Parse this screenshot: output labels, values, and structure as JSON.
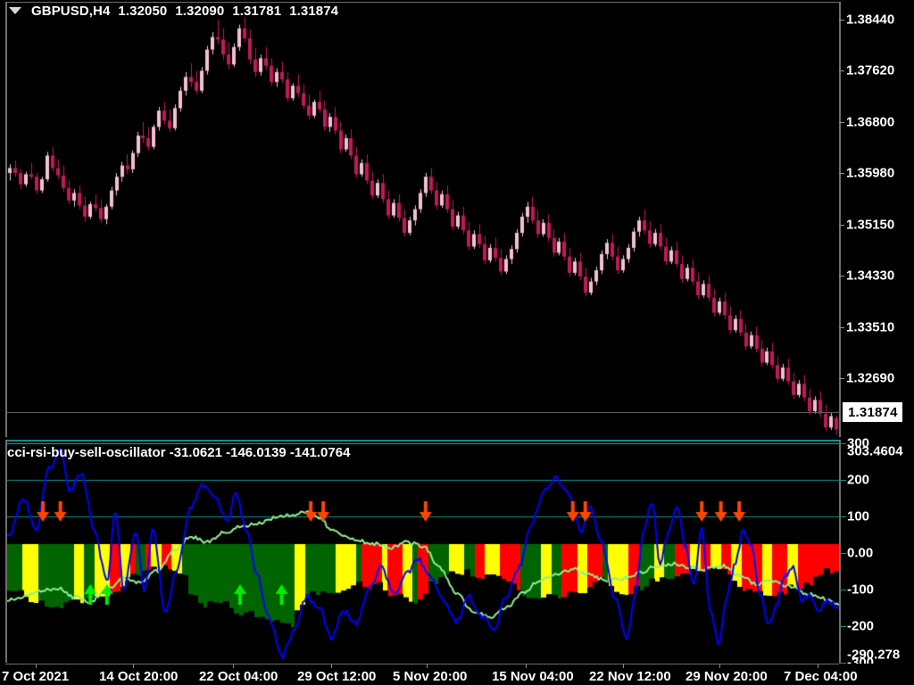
{
  "window": {
    "background": "#000000"
  },
  "header": {
    "dropdown_icon": "triangle-down-icon",
    "symbol": "GBPUSD,H4",
    "open": "1.32050",
    "high": "1.32090",
    "low": "1.31781",
    "close": "1.31874"
  },
  "price_pane": {
    "current_price": "1.31874",
    "scale_labels": [
      "1.38440",
      "1.37620",
      "1.36800",
      "1.35980",
      "1.35150",
      "1.34330",
      "1.33510",
      "1.32690"
    ]
  },
  "indicator_pane": {
    "name": "cci-rsi-buy-sell-oscillator",
    "value_1": "-31.0621",
    "value_2": "-146.0139",
    "value_3": "-141.0764",
    "scale_labels": [
      "300",
      "200",
      "100",
      "0.00",
      "-100",
      "-200",
      "-300"
    ],
    "scale_max_label": "303.4604",
    "scale_min_label": "-290.278",
    "colors": {
      "line_blue": "#0000ff",
      "line_green": "#90ee90",
      "grid_teal": "#0f8f8f",
      "bar_green": "#006400",
      "bar_red": "#ff0000",
      "bar_yellow": "#ffff00",
      "arrow_down": "#ff4500",
      "arrow_up": "#00ee00"
    }
  },
  "time_axis": {
    "labels": [
      "7 Oct 2021",
      "14 Oct 20:00",
      "22 Oct 04:00",
      "29 Oct 12:00",
      "5 Nov 20:00",
      "15 Nov 04:00",
      "22 Nov 12:00",
      "29 Nov 20:00",
      "7 Dec 04:00"
    ]
  },
  "chart_data": {
    "type": "line",
    "title": "GBPUSD,H4",
    "subtitle": "cci-rsi-buy-sell-oscillator",
    "xlabel": "",
    "ylabel": "",
    "panes": [
      {
        "name": "price",
        "type": "candlestick",
        "ylim": [
          1.312,
          1.389
        ],
        "yticks": [
          1.3844,
          1.3762,
          1.368,
          1.3598,
          1.3515,
          1.3433,
          1.3351,
          1.3269
        ],
        "current_price": 1.31874,
        "ohlc_header": {
          "open": 1.3205,
          "high": 1.3209,
          "low": 1.31781,
          "close": 1.31874
        },
        "up_color": "#f3c0cf",
        "down_color": "#c2185b",
        "candles": [
          [
            1.3598,
            1.3612,
            1.3586,
            1.3606
          ],
          [
            1.3606,
            1.3618,
            1.3592,
            1.3598
          ],
          [
            1.3598,
            1.3604,
            1.3572,
            1.358
          ],
          [
            1.358,
            1.36,
            1.3576,
            1.3596
          ],
          [
            1.3596,
            1.3614,
            1.3588,
            1.3592
          ],
          [
            1.3592,
            1.3598,
            1.3564,
            1.357
          ],
          [
            1.357,
            1.3592,
            1.3566,
            1.3588
          ],
          [
            1.3588,
            1.3632,
            1.3584,
            1.3626
          ],
          [
            1.3626,
            1.364,
            1.36,
            1.3606
          ],
          [
            1.3606,
            1.362,
            1.3588,
            1.3594
          ],
          [
            1.3594,
            1.361,
            1.3568,
            1.3574
          ],
          [
            1.3574,
            1.3586,
            1.3548,
            1.3554
          ],
          [
            1.3554,
            1.3572,
            1.3544,
            1.3566
          ],
          [
            1.3566,
            1.3578,
            1.354,
            1.3546
          ],
          [
            1.3546,
            1.356,
            1.352,
            1.3528
          ],
          [
            1.3528,
            1.3552,
            1.3524,
            1.3548
          ],
          [
            1.3548,
            1.3564,
            1.3536,
            1.3542
          ],
          [
            1.3542,
            1.3556,
            1.3518,
            1.3524
          ],
          [
            1.3524,
            1.3548,
            1.3516,
            1.3544
          ],
          [
            1.3544,
            1.3576,
            1.354,
            1.357
          ],
          [
            1.357,
            1.3598,
            1.3562,
            1.3592
          ],
          [
            1.3592,
            1.3616,
            1.3584,
            1.361
          ],
          [
            1.361,
            1.3628,
            1.3596,
            1.3604
          ],
          [
            1.3604,
            1.3634,
            1.3598,
            1.363
          ],
          [
            1.363,
            1.3664,
            1.3624,
            1.3658
          ],
          [
            1.3658,
            1.368,
            1.3646,
            1.3654
          ],
          [
            1.3654,
            1.3672,
            1.3634,
            1.364
          ],
          [
            1.364,
            1.3676,
            1.3636,
            1.3672
          ],
          [
            1.3672,
            1.3704,
            1.3666,
            1.3698
          ],
          [
            1.3698,
            1.3712,
            1.3676,
            1.3682
          ],
          [
            1.3682,
            1.37,
            1.3664,
            1.367
          ],
          [
            1.367,
            1.3708,
            1.3666,
            1.3702
          ],
          [
            1.3702,
            1.3736,
            1.3696,
            1.373
          ],
          [
            1.373,
            1.376,
            1.3722,
            1.3752
          ],
          [
            1.3752,
            1.3774,
            1.3736,
            1.3744
          ],
          [
            1.3744,
            1.3762,
            1.3724,
            1.373
          ],
          [
            1.373,
            1.3768,
            1.3726,
            1.3762
          ],
          [
            1.3762,
            1.3802,
            1.3756,
            1.3796
          ],
          [
            1.3796,
            1.3824,
            1.3788,
            1.3816
          ],
          [
            1.3816,
            1.3844,
            1.3804,
            1.3812
          ],
          [
            1.3812,
            1.383,
            1.378,
            1.3788
          ],
          [
            1.3788,
            1.3808,
            1.3764,
            1.3772
          ],
          [
            1.3772,
            1.3806,
            1.3768,
            1.38
          ],
          [
            1.38,
            1.3836,
            1.3794,
            1.383
          ],
          [
            1.383,
            1.3848,
            1.3808,
            1.3814
          ],
          [
            1.3814,
            1.3828,
            1.3772,
            1.378
          ],
          [
            1.378,
            1.3798,
            1.3752,
            1.376
          ],
          [
            1.376,
            1.3788,
            1.3754,
            1.3782
          ],
          [
            1.3782,
            1.38,
            1.3764,
            1.377
          ],
          [
            1.377,
            1.3782,
            1.3738,
            1.3744
          ],
          [
            1.3744,
            1.3766,
            1.3736,
            1.376
          ],
          [
            1.376,
            1.3776,
            1.3742,
            1.3748
          ],
          [
            1.3748,
            1.376,
            1.3712,
            1.3718
          ],
          [
            1.3718,
            1.3742,
            1.3714,
            1.3738
          ],
          [
            1.3738,
            1.3756,
            1.372,
            1.3726
          ],
          [
            1.3726,
            1.374,
            1.37,
            1.3706
          ],
          [
            1.3706,
            1.3724,
            1.3684,
            1.369
          ],
          [
            1.369,
            1.3716,
            1.3686,
            1.3712
          ],
          [
            1.3712,
            1.373,
            1.3694,
            1.37
          ],
          [
            1.37,
            1.3714,
            1.3666,
            1.3672
          ],
          [
            1.3672,
            1.3694,
            1.3664,
            1.3688
          ],
          [
            1.3688,
            1.3704,
            1.366,
            1.3666
          ],
          [
            1.3666,
            1.368,
            1.363,
            1.3636
          ],
          [
            1.3636,
            1.366,
            1.3632,
            1.3654
          ],
          [
            1.3654,
            1.3668,
            1.362,
            1.3626
          ],
          [
            1.3626,
            1.364,
            1.359,
            1.3596
          ],
          [
            1.3596,
            1.362,
            1.3592,
            1.3614
          ],
          [
            1.3614,
            1.3628,
            1.358,
            1.3586
          ],
          [
            1.3586,
            1.36,
            1.3556,
            1.3562
          ],
          [
            1.3562,
            1.3588,
            1.3558,
            1.3582
          ],
          [
            1.3582,
            1.3596,
            1.355,
            1.3556
          ],
          [
            1.3556,
            1.357,
            1.3524,
            1.353
          ],
          [
            1.353,
            1.3556,
            1.3526,
            1.355
          ],
          [
            1.355,
            1.3564,
            1.352,
            1.3526
          ],
          [
            1.3526,
            1.354,
            1.3496,
            1.3502
          ],
          [
            1.3502,
            1.3528,
            1.3498,
            1.3522
          ],
          [
            1.3522,
            1.3546,
            1.3514,
            1.354
          ],
          [
            1.354,
            1.3572,
            1.3534,
            1.3566
          ],
          [
            1.3566,
            1.3598,
            1.356,
            1.3592
          ],
          [
            1.3592,
            1.3606,
            1.3564,
            1.357
          ],
          [
            1.357,
            1.3584,
            1.354,
            1.3546
          ],
          [
            1.3546,
            1.357,
            1.3542,
            1.3564
          ],
          [
            1.3564,
            1.3578,
            1.3534,
            1.354
          ],
          [
            1.354,
            1.3554,
            1.3506,
            1.3512
          ],
          [
            1.3512,
            1.3536,
            1.3508,
            1.353
          ],
          [
            1.353,
            1.3544,
            1.35,
            1.3506
          ],
          [
            1.3506,
            1.352,
            1.3474,
            1.348
          ],
          [
            1.348,
            1.3506,
            1.3476,
            1.35
          ],
          [
            1.35,
            1.3516,
            1.3478,
            1.3484
          ],
          [
            1.3484,
            1.3498,
            1.3452,
            1.3458
          ],
          [
            1.3458,
            1.3484,
            1.3454,
            1.3478
          ],
          [
            1.3478,
            1.3494,
            1.3456,
            1.3462
          ],
          [
            1.3462,
            1.3476,
            1.3434,
            1.344
          ],
          [
            1.344,
            1.3466,
            1.3436,
            1.346
          ],
          [
            1.346,
            1.3482,
            1.3452,
            1.3476
          ],
          [
            1.3476,
            1.3508,
            1.347,
            1.3502
          ],
          [
            1.3502,
            1.3534,
            1.3496,
            1.3528
          ],
          [
            1.3528,
            1.3552,
            1.3518,
            1.3544
          ],
          [
            1.3544,
            1.356,
            1.3516,
            1.3522
          ],
          [
            1.3522,
            1.3538,
            1.3494,
            1.35
          ],
          [
            1.35,
            1.3524,
            1.3496,
            1.3518
          ],
          [
            1.3518,
            1.3532,
            1.3488,
            1.3494
          ],
          [
            1.3494,
            1.3508,
            1.3464,
            1.347
          ],
          [
            1.347,
            1.3494,
            1.3466,
            1.3488
          ],
          [
            1.3488,
            1.3502,
            1.3458,
            1.3464
          ],
          [
            1.3464,
            1.3478,
            1.3432,
            1.3438
          ],
          [
            1.3438,
            1.3462,
            1.3434,
            1.3456
          ],
          [
            1.3456,
            1.347,
            1.3426,
            1.3432
          ],
          [
            1.3432,
            1.3446,
            1.34,
            1.3406
          ],
          [
            1.3406,
            1.343,
            1.3402,
            1.3424
          ],
          [
            1.3424,
            1.3448,
            1.3418,
            1.3442
          ],
          [
            1.3442,
            1.3474,
            1.3436,
            1.3468
          ],
          [
            1.3468,
            1.3492,
            1.346,
            1.3486
          ],
          [
            1.3486,
            1.35,
            1.3458,
            1.3464
          ],
          [
            1.3464,
            1.348,
            1.3436,
            1.3442
          ],
          [
            1.3442,
            1.3466,
            1.3438,
            1.346
          ],
          [
            1.346,
            1.3484,
            1.3454,
            1.3478
          ],
          [
            1.3478,
            1.351,
            1.3472,
            1.3504
          ],
          [
            1.3504,
            1.3528,
            1.3496,
            1.3522
          ],
          [
            1.3522,
            1.354,
            1.35,
            1.3506
          ],
          [
            1.3506,
            1.352,
            1.3478,
            1.3484
          ],
          [
            1.3484,
            1.3508,
            1.348,
            1.3502
          ],
          [
            1.3502,
            1.3516,
            1.3474,
            1.348
          ],
          [
            1.348,
            1.3494,
            1.345,
            1.3456
          ],
          [
            1.3456,
            1.348,
            1.3452,
            1.3474
          ],
          [
            1.3474,
            1.3488,
            1.3446,
            1.3452
          ],
          [
            1.3452,
            1.3466,
            1.3422,
            1.3428
          ],
          [
            1.3428,
            1.3452,
            1.3424,
            1.3446
          ],
          [
            1.3446,
            1.346,
            1.3418,
            1.3424
          ],
          [
            1.3424,
            1.3438,
            1.3396,
            1.3402
          ],
          [
            1.3402,
            1.3426,
            1.3398,
            1.342
          ],
          [
            1.342,
            1.3434,
            1.3392,
            1.3398
          ],
          [
            1.3398,
            1.3412,
            1.3368,
            1.3374
          ],
          [
            1.3374,
            1.3398,
            1.337,
            1.3392
          ],
          [
            1.3392,
            1.3406,
            1.3364,
            1.337
          ],
          [
            1.337,
            1.3384,
            1.334,
            1.3346
          ],
          [
            1.3346,
            1.337,
            1.3342,
            1.3364
          ],
          [
            1.3364,
            1.3378,
            1.3336,
            1.3342
          ],
          [
            1.3342,
            1.3356,
            1.3314,
            1.332
          ],
          [
            1.332,
            1.3344,
            1.3316,
            1.3338
          ],
          [
            1.3338,
            1.3352,
            1.331,
            1.3316
          ],
          [
            1.3316,
            1.333,
            1.3288,
            1.3294
          ],
          [
            1.3294,
            1.3318,
            1.329,
            1.3312
          ],
          [
            1.3312,
            1.3326,
            1.3284,
            1.329
          ],
          [
            1.329,
            1.3304,
            1.3262,
            1.3268
          ],
          [
            1.3268,
            1.3292,
            1.3264,
            1.3286
          ],
          [
            1.3286,
            1.33,
            1.3258,
            1.3264
          ],
          [
            1.3264,
            1.3278,
            1.3236,
            1.3242
          ],
          [
            1.3242,
            1.3266,
            1.3238,
            1.326
          ],
          [
            1.326,
            1.3274,
            1.3232,
            1.3238
          ],
          [
            1.3238,
            1.3252,
            1.321,
            1.3216
          ],
          [
            1.3216,
            1.324,
            1.3212,
            1.3234
          ],
          [
            1.3234,
            1.3248,
            1.3206,
            1.3212
          ],
          [
            1.3212,
            1.3226,
            1.3184,
            1.319
          ],
          [
            1.319,
            1.3214,
            1.3186,
            1.3208
          ],
          [
            1.3205,
            1.3209,
            1.3178,
            1.3187
          ]
        ]
      },
      {
        "name": "oscillator",
        "type": "line+histogram",
        "ylim": [
          -300,
          300
        ],
        "yticks": [
          300,
          200,
          100,
          0,
          -100,
          -200,
          -300
        ],
        "gridlines": [
          300,
          200,
          100,
          0,
          -100,
          -200,
          -300
        ],
        "series": [
          {
            "name": "cci-blue",
            "color": "#0000ff"
          },
          {
            "name": "rsi-green",
            "color": "#90ee90"
          }
        ],
        "signals": {
          "sell_arrows_x_pct": [
            4.3,
            6.4,
            36.5,
            38.0,
            50.3,
            68.0,
            69.5,
            83.5,
            85.8,
            88.0
          ],
          "buy_arrows_x_pct": [
            10.0,
            12.0,
            28.0,
            33.0
          ]
        }
      }
    ]
  }
}
